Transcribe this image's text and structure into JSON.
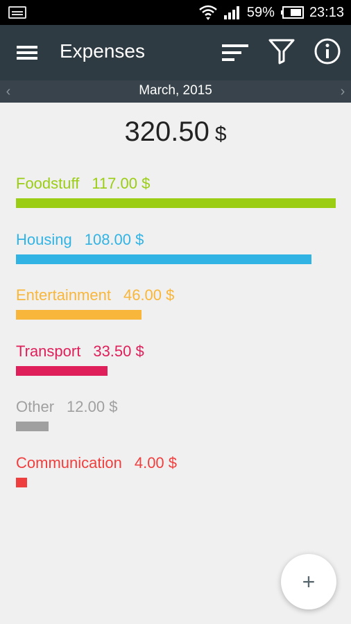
{
  "status_bar": {
    "battery_percent": "59%",
    "time": "23:13"
  },
  "toolbar": {
    "title": "Expenses"
  },
  "period": {
    "label": "March, 2015"
  },
  "total": {
    "amount": "320.50",
    "currency": "$"
  },
  "categories": [
    {
      "name": "Foodstuff",
      "amount": "117.00 $",
      "value": 117.0,
      "color": "#9acd14"
    },
    {
      "name": "Housing",
      "amount": "108.00 $",
      "value": 108.0,
      "color": "#31b3e4"
    },
    {
      "name": "Entertainment",
      "amount": "46.00 $",
      "value": 46.0,
      "color": "#f8b63a"
    },
    {
      "name": "Transport",
      "amount": "33.50 $",
      "value": 33.5,
      "color": "#df1f5a"
    },
    {
      "name": "Other",
      "amount": "12.00 $",
      "value": 12.0,
      "color": "#a0a0a0"
    },
    {
      "name": "Communication",
      "amount": "4.00 $",
      "value": 4.0,
      "color": "#ef3e3e"
    }
  ],
  "fab": {
    "label": "+"
  }
}
